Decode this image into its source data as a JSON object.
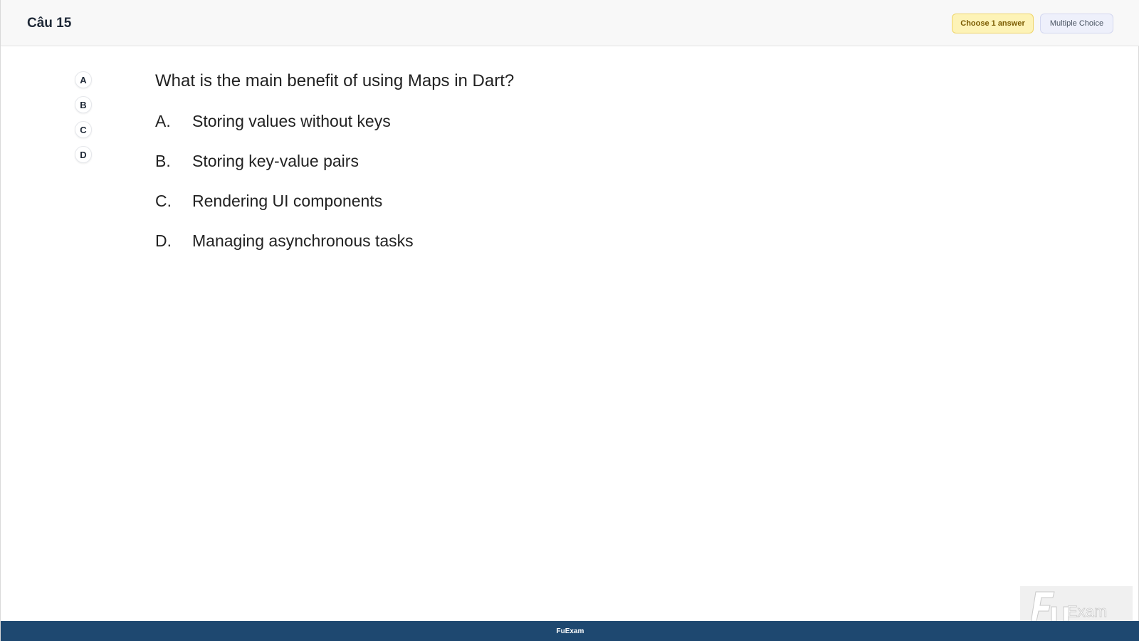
{
  "header": {
    "question_label": "Câu 15",
    "choose_badge": "Choose 1 answer",
    "type_badge": "Multiple Choice"
  },
  "answer_nav": [
    "A",
    "B",
    "C",
    "D"
  ],
  "question": {
    "text": "What is the main benefit of using Maps in Dart?",
    "options": [
      {
        "letter": "A.",
        "text": "Storing values without keys"
      },
      {
        "letter": "B.",
        "text": "Storing key-value pairs"
      },
      {
        "letter": "C.",
        "text": "Rendering UI components"
      },
      {
        "letter": "D.",
        "text": "Managing asynchronous tasks"
      }
    ]
  },
  "watermark": {
    "logo_text": "FUExam"
  },
  "footer": {
    "label": "FuExam"
  },
  "colors": {
    "footer_bg": "#1e4870",
    "choose_badge_bg": "#fdf3b7",
    "type_badge_bg": "#eef0fb"
  }
}
